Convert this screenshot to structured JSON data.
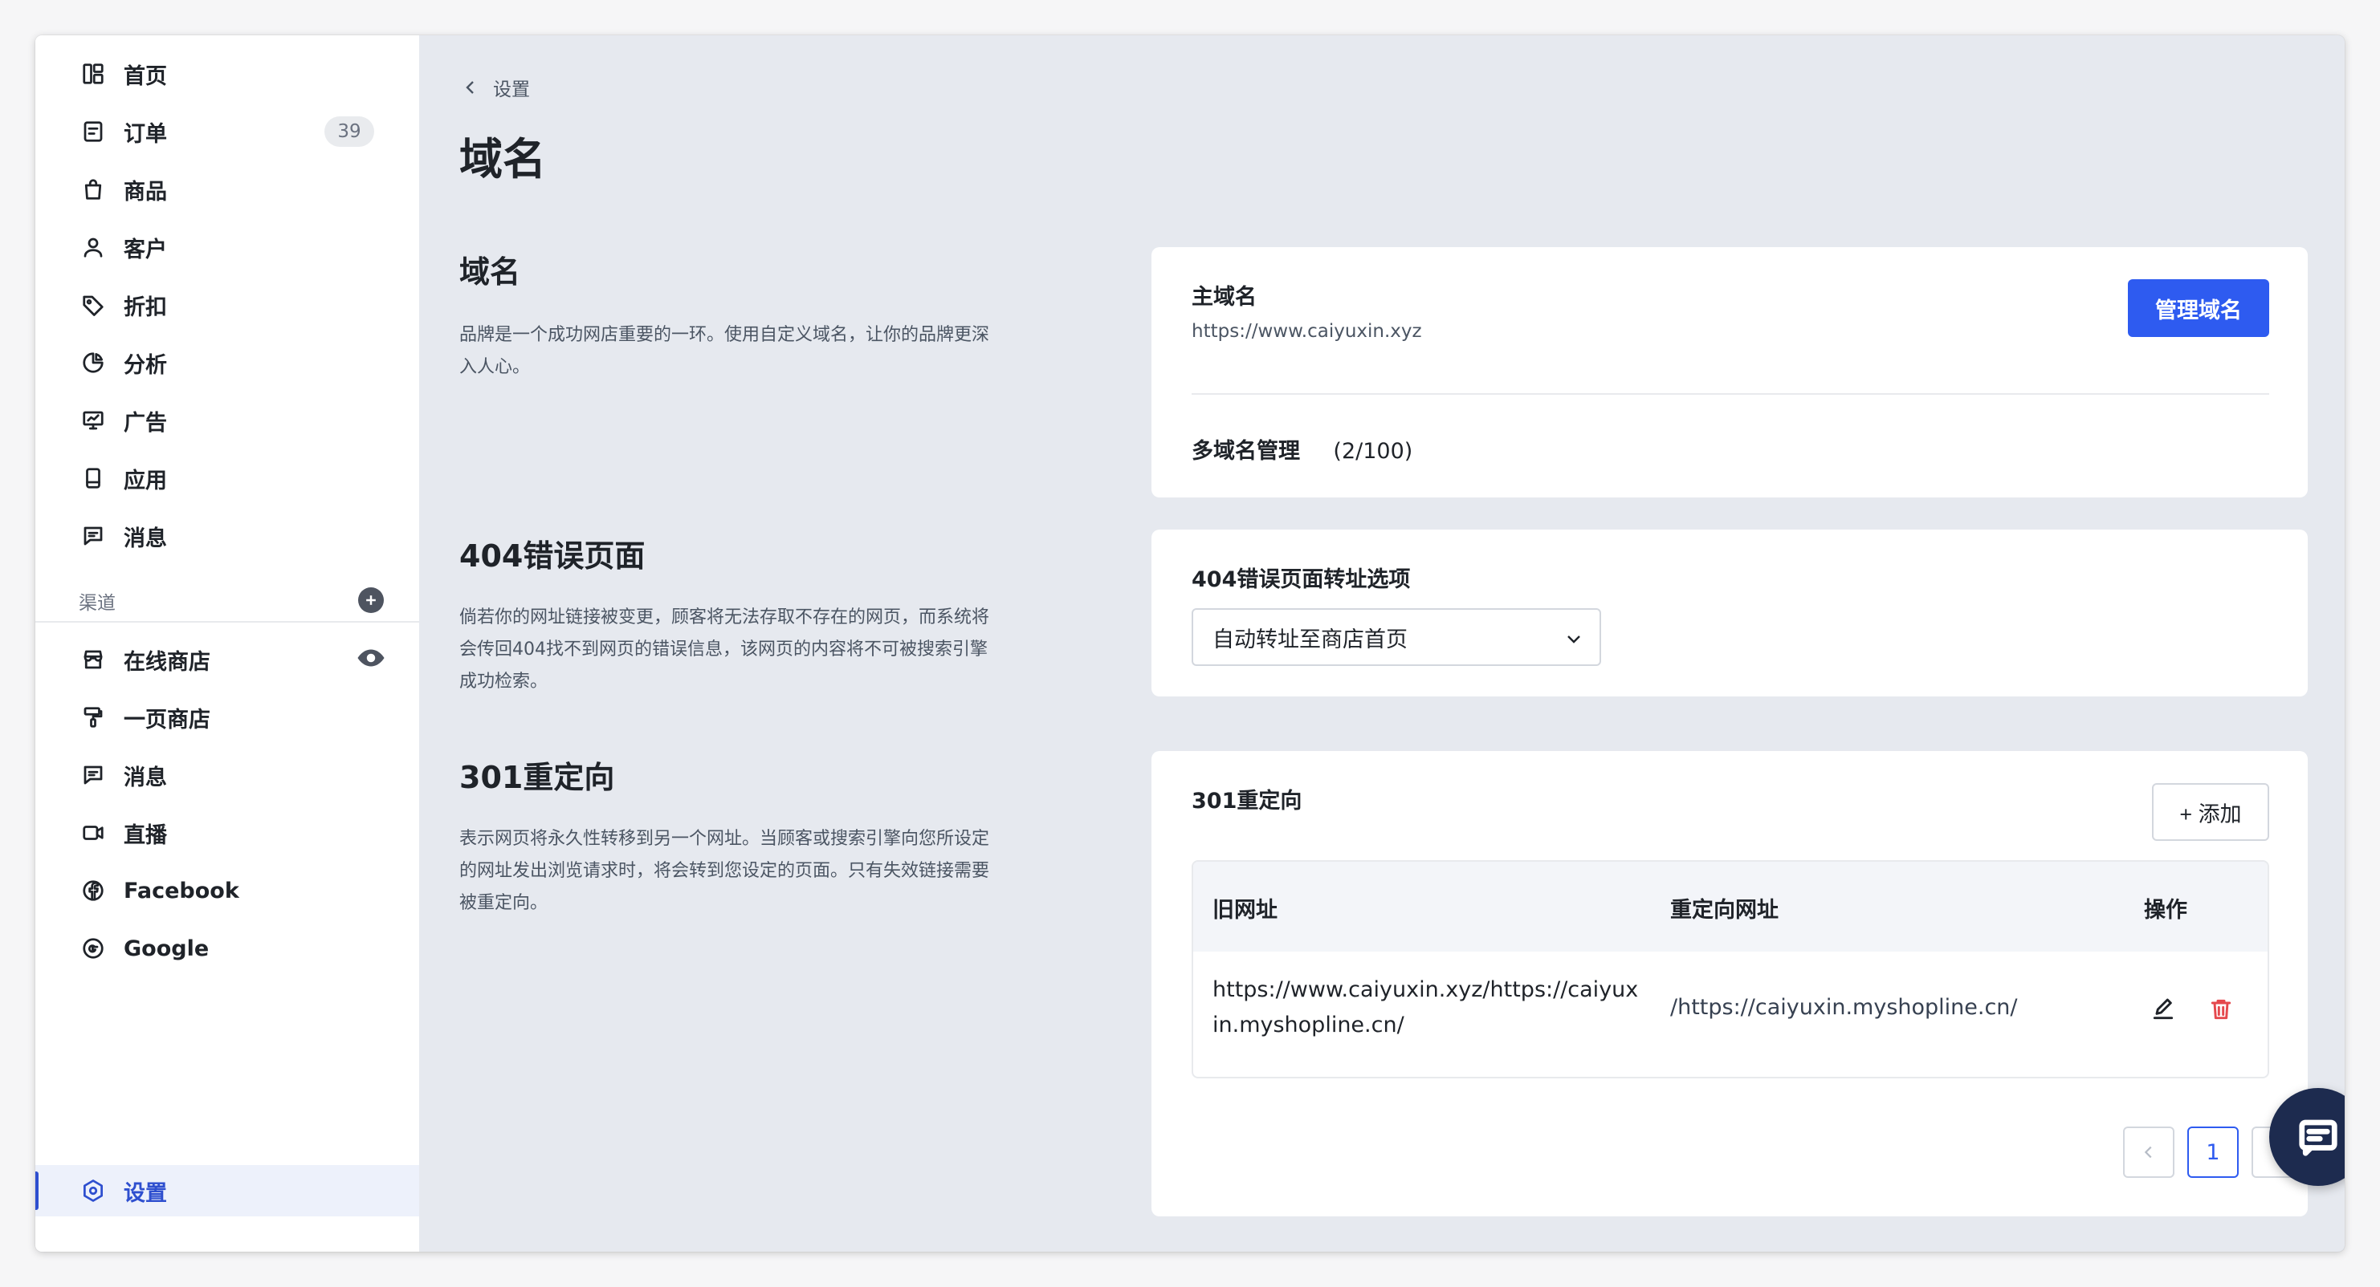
{
  "sidebar": {
    "items": [
      {
        "label": "首页",
        "icon": "dashboard-icon"
      },
      {
        "label": "订单",
        "icon": "order-icon",
        "badge": "39"
      },
      {
        "label": "商品",
        "icon": "shopping-bag-icon"
      },
      {
        "label": "客户",
        "icon": "user-icon"
      },
      {
        "label": "折扣",
        "icon": "tag-icon"
      },
      {
        "label": "分析",
        "icon": "pie-chart-icon"
      },
      {
        "label": "广告",
        "icon": "monitor-icon"
      },
      {
        "label": "应用",
        "icon": "app-icon"
      },
      {
        "label": "消息",
        "icon": "message-icon"
      }
    ],
    "channel_label": "渠道",
    "channels": [
      {
        "label": "在线商店",
        "icon": "store-icon"
      },
      {
        "label": "一页商店",
        "icon": "paint-roller-icon"
      },
      {
        "label": "消息",
        "icon": "message-icon"
      },
      {
        "label": "直播",
        "icon": "video-icon"
      },
      {
        "label": "Facebook",
        "icon": "facebook-icon"
      },
      {
        "label": "Google",
        "icon": "google-icon"
      }
    ],
    "settings_label": "设置"
  },
  "header": {
    "back_label": "设置",
    "title": "域名"
  },
  "sections": {
    "domain": {
      "title": "域名",
      "desc_line1": "品牌是一个成功网店重要的一环。使用自定义域名，让你的品牌更深",
      "desc_line2": "入人心。"
    },
    "error404": {
      "title": "404错误页面",
      "desc_line1": "倘若你的网址链接被变更，顾客将无法存取不存在的网页，而系统将",
      "desc_line2": "会传回404找不到网页的错误信息，该网页的内容将不可被搜索引擎",
      "desc_line3": "成功检索。"
    },
    "redirect301": {
      "title": "301重定向",
      "desc_line1": "表示网页将永久性转移到另一个网址。当顾客或搜索引擎向您所设定",
      "desc_line2": "的网址发出浏览请求时，将会转到您设定的页面。只有失效链接需要",
      "desc_line3": "被重定向。"
    }
  },
  "domain_card": {
    "primary_label": "主域名",
    "primary_url": "https://www.caiyuxin.xyz",
    "manage_button": "管理域名",
    "multi_label": "多域名管理",
    "multi_count": "(2/100)"
  },
  "error_card": {
    "label": "404错误页面转址选项",
    "selected": "自动转址至商店首页"
  },
  "redirect_card": {
    "label": "301重定向",
    "add_button": "+ 添加",
    "columns": [
      "旧网址",
      "重定向网址",
      "操作"
    ],
    "rows": [
      {
        "old_line1": "https://www.caiyuxin.xyz/https://caiyux",
        "old_line2": "in.myshopline.cn/",
        "new": "/https://caiyuxin.myshopline.cn/"
      }
    ],
    "current_page": "1"
  },
  "colors": {
    "accent": "#2e5bf0",
    "danger": "#e5484d",
    "fab": "#1d2b4f"
  }
}
